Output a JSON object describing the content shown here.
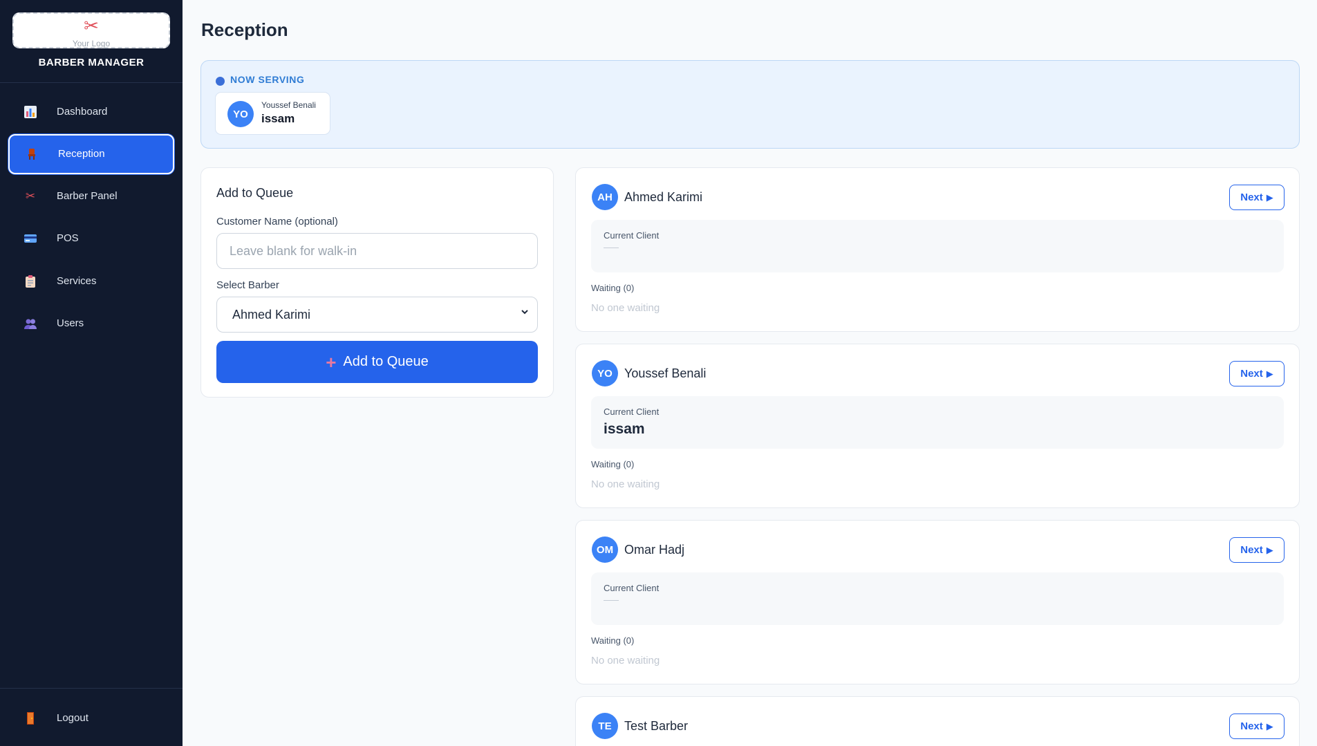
{
  "sidebar": {
    "logo_text": "Your Logo",
    "brand": "BARBER MANAGER",
    "items": [
      {
        "label": "Dashboard",
        "icon": "chart-icon"
      },
      {
        "label": "Reception",
        "icon": "chair-icon",
        "active": true
      },
      {
        "label": "Barber Panel",
        "icon": "scissors-icon"
      },
      {
        "label": "POS",
        "icon": "credit-card-icon"
      },
      {
        "label": "Services",
        "icon": "clipboard-icon"
      },
      {
        "label": "Users",
        "icon": "users-icon"
      }
    ],
    "logout": {
      "label": "Logout",
      "icon": "door-icon"
    }
  },
  "page": {
    "title": "Reception"
  },
  "now_serving": {
    "label": "NOW SERVING",
    "entries": [
      {
        "initials": "YO",
        "barber": "Youssef Benali",
        "client": "issam"
      }
    ]
  },
  "add_queue": {
    "title": "Add to Queue",
    "name_label": "Customer Name (optional)",
    "name_placeholder": "Leave blank for walk-in",
    "name_value": "",
    "barber_label": "Select Barber",
    "barber_selected": "Ahmed Karimi",
    "button_label": "Add to Queue"
  },
  "barbers": [
    {
      "initials": "AH",
      "name": "Ahmed Karimi",
      "next_label": "Next",
      "current_label": "Current Client",
      "current_client": "",
      "waiting_label": "Waiting (0)",
      "waiting_empty": "No one waiting"
    },
    {
      "initials": "YO",
      "name": "Youssef Benali",
      "next_label": "Next",
      "current_label": "Current Client",
      "current_client": "issam",
      "waiting_label": "Waiting (0)",
      "waiting_empty": "No one waiting"
    },
    {
      "initials": "OM",
      "name": "Omar Hadj",
      "next_label": "Next",
      "current_label": "Current Client",
      "current_client": "",
      "waiting_label": "Waiting (0)",
      "waiting_empty": "No one waiting"
    },
    {
      "initials": "TE",
      "name": "Test Barber",
      "next_label": "Next"
    }
  ],
  "colors": {
    "sidebar_bg": "#111a2e",
    "accent": "#2563eb",
    "avatar": "#3b82f6",
    "now_serving_bg": "#eaf3fe"
  }
}
